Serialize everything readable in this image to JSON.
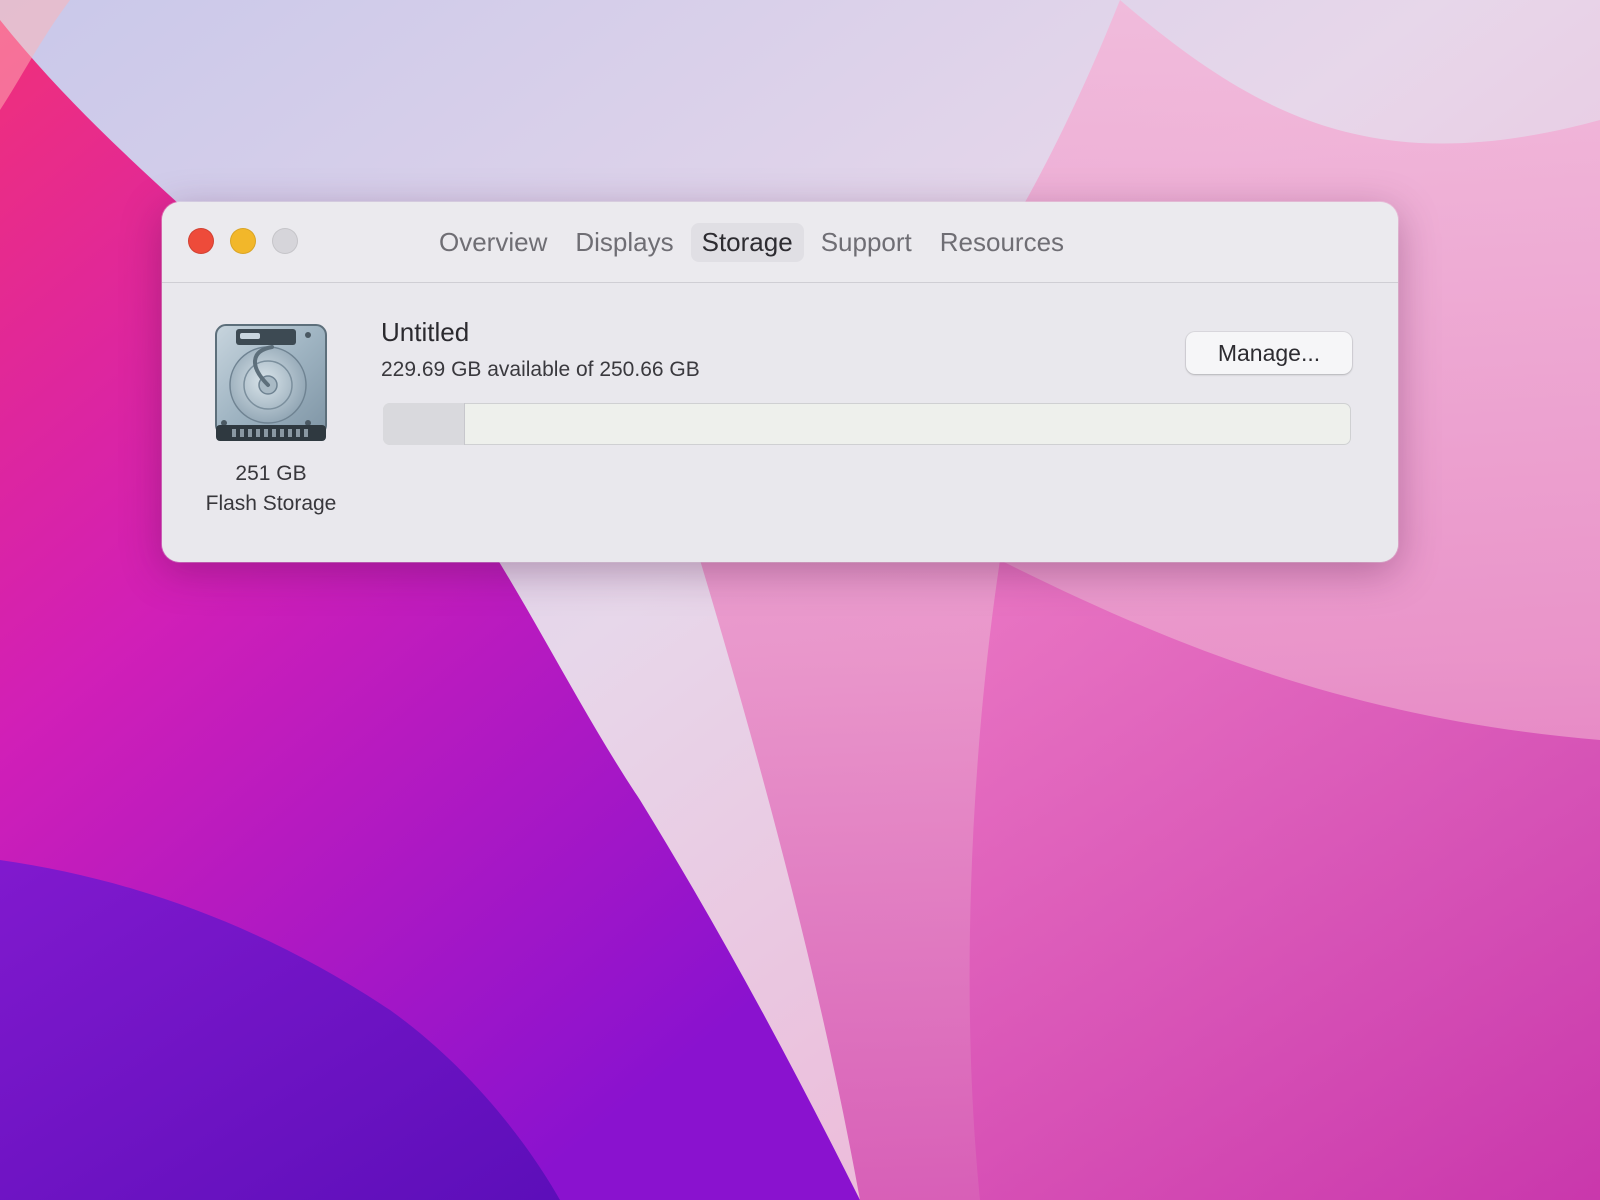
{
  "window": {
    "controls": {
      "close": "close-button",
      "minimize": "minimize-button",
      "zoom": "zoom-button"
    },
    "tabs": [
      {
        "label": "Overview",
        "active": false
      },
      {
        "label": "Displays",
        "active": false
      },
      {
        "label": "Storage",
        "active": true
      },
      {
        "label": "Support",
        "active": false
      },
      {
        "label": "Resources",
        "active": false
      }
    ]
  },
  "storage": {
    "disk": {
      "icon": "hard-drive-icon",
      "size": "251 GB",
      "type": "Flash Storage"
    },
    "volume": {
      "name": "Untitled",
      "availability": "229.69 GB available of 250.66 GB"
    },
    "manage_label": "Manage...",
    "used_fraction": 0.084
  },
  "colors": {
    "close": "#ee4b3a",
    "minimize": "#f2b72a",
    "zoom": "#d6d5da",
    "window_bg": "#e9e8ed"
  }
}
